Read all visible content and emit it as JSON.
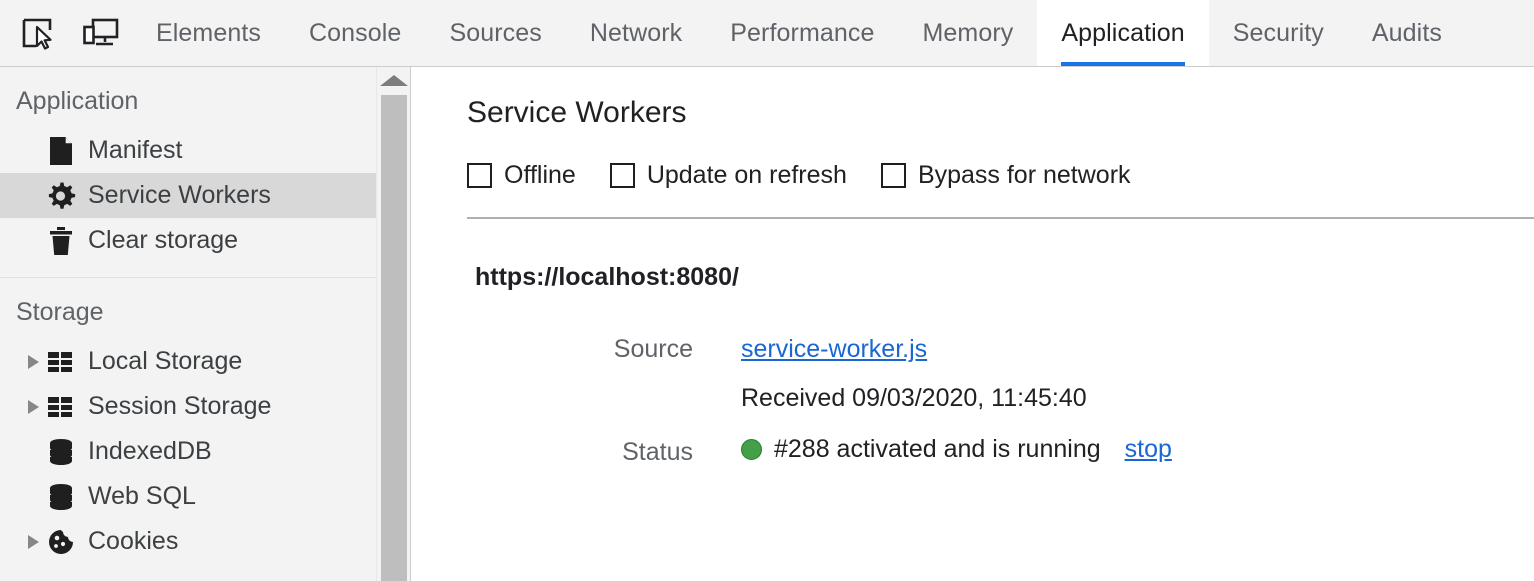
{
  "window": {
    "app": "Chrome DevTools"
  },
  "toolbar": {
    "icons": [
      {
        "name": "inspect-element-icon",
        "title": "Inspect element"
      },
      {
        "name": "device-toolbar-icon",
        "title": "Toggle device toolbar"
      }
    ]
  },
  "tabs": [
    {
      "label": "Elements",
      "active": false
    },
    {
      "label": "Console",
      "active": false
    },
    {
      "label": "Sources",
      "active": false
    },
    {
      "label": "Network",
      "active": false
    },
    {
      "label": "Performance",
      "active": false
    },
    {
      "label": "Memory",
      "active": false
    },
    {
      "label": "Application",
      "active": true
    },
    {
      "label": "Security",
      "active": false
    },
    {
      "label": "Audits",
      "active": false
    }
  ],
  "accent_color": "#1a73e8",
  "sidebar": {
    "sections": [
      {
        "title": "Application",
        "items": [
          {
            "label": "Manifest",
            "icon": "document-icon",
            "expandable": false,
            "selected": false
          },
          {
            "label": "Service Workers",
            "icon": "gear-icon",
            "expandable": false,
            "selected": true
          },
          {
            "label": "Clear storage",
            "icon": "trash-icon",
            "expandable": false,
            "selected": false
          }
        ]
      },
      {
        "title": "Storage",
        "items": [
          {
            "label": "Local Storage",
            "icon": "table-icon",
            "expandable": true,
            "selected": false
          },
          {
            "label": "Session Storage",
            "icon": "table-icon",
            "expandable": true,
            "selected": false
          },
          {
            "label": "IndexedDB",
            "icon": "database-icon",
            "expandable": false,
            "selected": false
          },
          {
            "label": "Web SQL",
            "icon": "database-icon",
            "expandable": false,
            "selected": false
          },
          {
            "label": "Cookies",
            "icon": "cookie-icon",
            "expandable": true,
            "selected": false
          }
        ]
      }
    ],
    "scrollbar": {
      "name": "sidebar-scrollbar",
      "arrow": "scroll-up-arrow"
    }
  },
  "main": {
    "title": "Service Workers",
    "checkboxes": [
      {
        "label": "Offline",
        "checked": false
      },
      {
        "label": "Update on refresh",
        "checked": false
      },
      {
        "label": "Bypass for network",
        "checked": false
      }
    ],
    "origin": "https://localhost:8080/",
    "rows": {
      "source_label": "Source",
      "source_value": "service-worker.js",
      "received_text": "Received 09/03/2020, 11:45:40",
      "status_label": "Status",
      "status_text": "#288 activated and is running",
      "status_action": "stop",
      "status_color": "#43a047"
    }
  }
}
